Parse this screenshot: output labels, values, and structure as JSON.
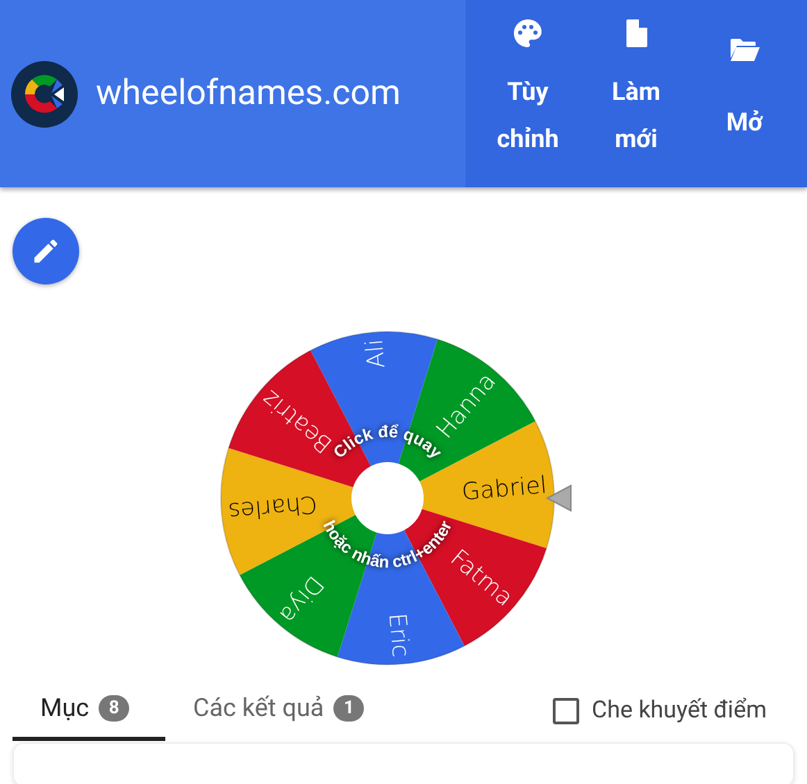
{
  "header": {
    "site_name": "wheelofnames.com",
    "buttons": [
      {
        "kind": "palette",
        "label": "Tùy chỉnh"
      },
      {
        "kind": "file",
        "label": "Làm mới"
      },
      {
        "kind": "folder",
        "label": "Mở"
      }
    ]
  },
  "wheel": {
    "slices": [
      {
        "name": "Ali",
        "color": "#3369e8"
      },
      {
        "name": "Hanna",
        "color": "#009925"
      },
      {
        "name": "Gabriel",
        "color": "#eeb211"
      },
      {
        "name": "Fatma",
        "color": "#d50f25"
      },
      {
        "name": "Eric",
        "color": "#3369e8"
      },
      {
        "name": "Diya",
        "color": "#009925"
      },
      {
        "name": "Charles",
        "color": "#eeb211"
      },
      {
        "name": "Beatriz",
        "color": "#d50f25"
      }
    ],
    "hint_top": "Click để quay",
    "hint_bottom": "hoặc nhấn ctrl+enter"
  },
  "tabs": [
    {
      "label": "Mục",
      "count": "8",
      "selected": true
    },
    {
      "label": "Các kết quả",
      "count": "1",
      "selected": false
    }
  ],
  "hide_option": {
    "label": "Che khuyết điểm",
    "checked": false
  }
}
